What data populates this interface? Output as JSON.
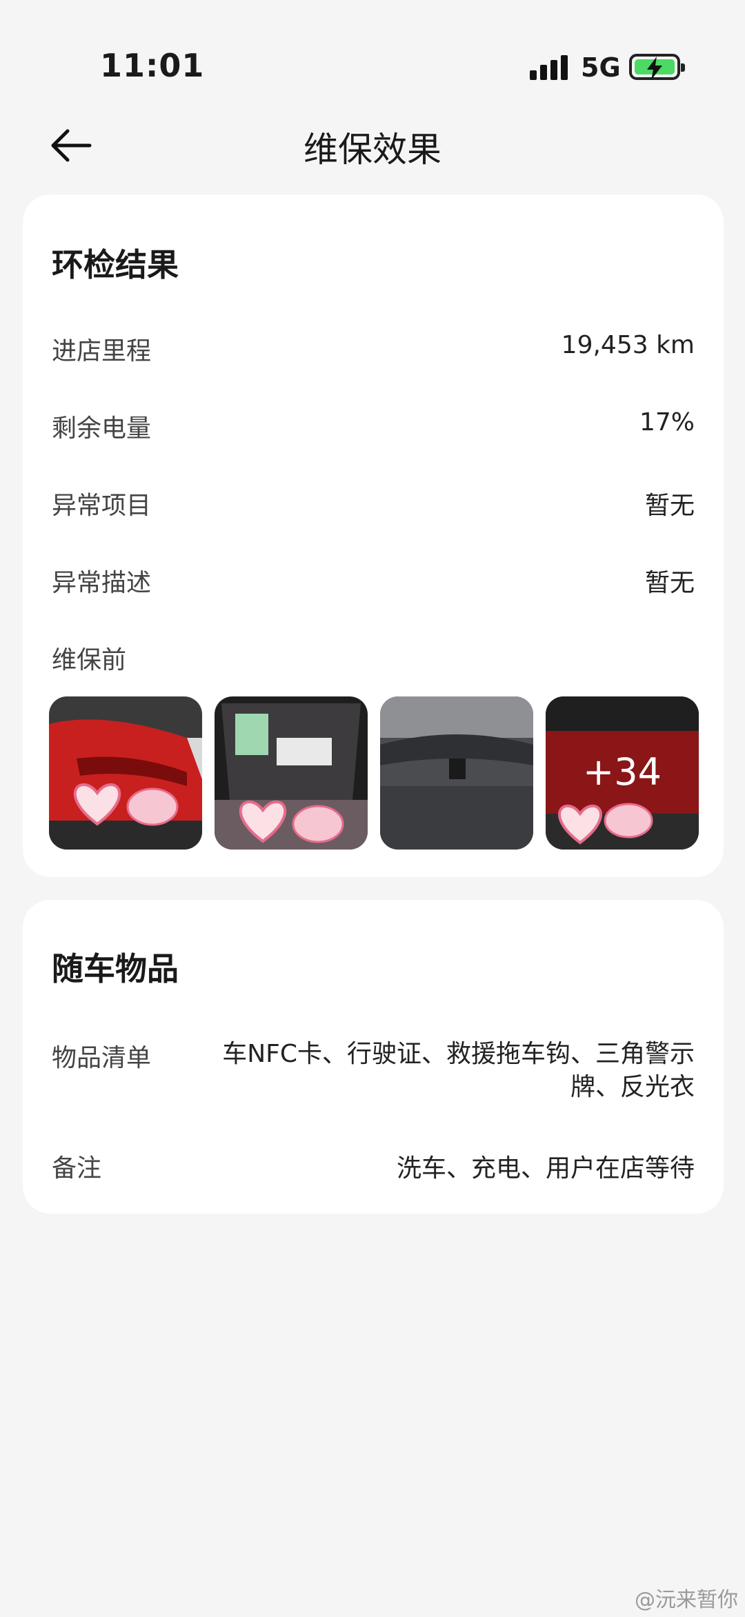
{
  "status_bar": {
    "time": "11:01",
    "network": "5G",
    "battery_color": "#4cd964",
    "icons": [
      "signal-icon",
      "battery-charging-icon"
    ]
  },
  "header": {
    "title": "维保效果",
    "back_icon": "arrow-left-icon"
  },
  "inspection": {
    "title": "环检结果",
    "rows": [
      {
        "label": "进店里程",
        "value": "19,453 km"
      },
      {
        "label": "剩余电量",
        "value": "17%"
      },
      {
        "label": "异常项目",
        "value": "暂无"
      },
      {
        "label": "异常描述",
        "value": "暂无"
      }
    ],
    "before_label": "维保前",
    "more_photos": "+34"
  },
  "belongings": {
    "title": "随车物品",
    "items_label": "物品清单",
    "items_value": "车NFC卡、行驶证、救援拖车钩、三角警示牌、反光衣",
    "note_label": "备注",
    "note_value": "洗车、充电、用户在店等待"
  },
  "watermark": "@沅来暂你"
}
